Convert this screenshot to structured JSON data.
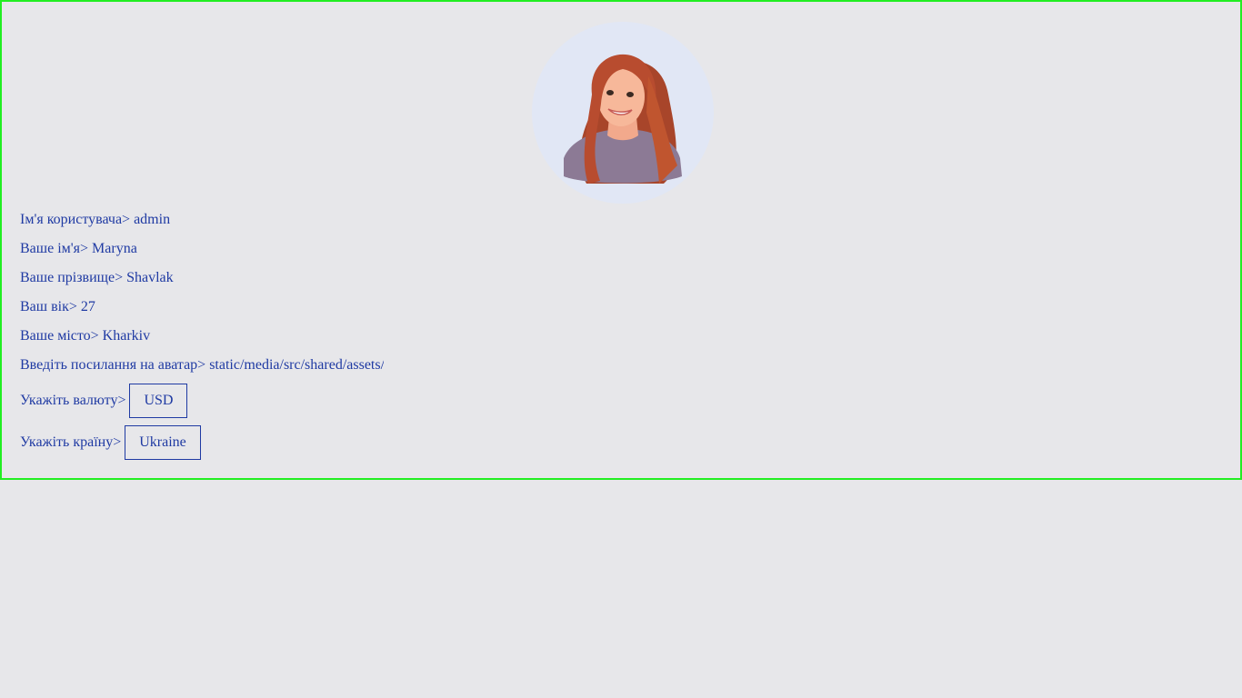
{
  "profile": {
    "avatar_alt": "avatar",
    "fields": {
      "username": {
        "label": "Ім'я користувача>",
        "value": "admin"
      },
      "first_name": {
        "label": "Ваше ім'я>",
        "value": "Maryna"
      },
      "last_name": {
        "label": "Ваше прізвище>",
        "value": "Shavlak"
      },
      "age": {
        "label": "Ваш вік>",
        "value": "27"
      },
      "city": {
        "label": "Ваше місто>",
        "value": "Kharkiv"
      },
      "avatar_link": {
        "label": "Введіть посилання на аватар>",
        "value": "static/media/src/shared/assets/"
      }
    },
    "currency": {
      "label": "Укажіть валюту>",
      "value": "USD"
    },
    "country": {
      "label": "Укажіть країну>",
      "value": "Ukraine"
    }
  },
  "colors": {
    "page_background": "#e7e7ea",
    "text": "#1f3aa3",
    "card_border": "#22ee22",
    "avatar_background": "#e1e7f5"
  }
}
